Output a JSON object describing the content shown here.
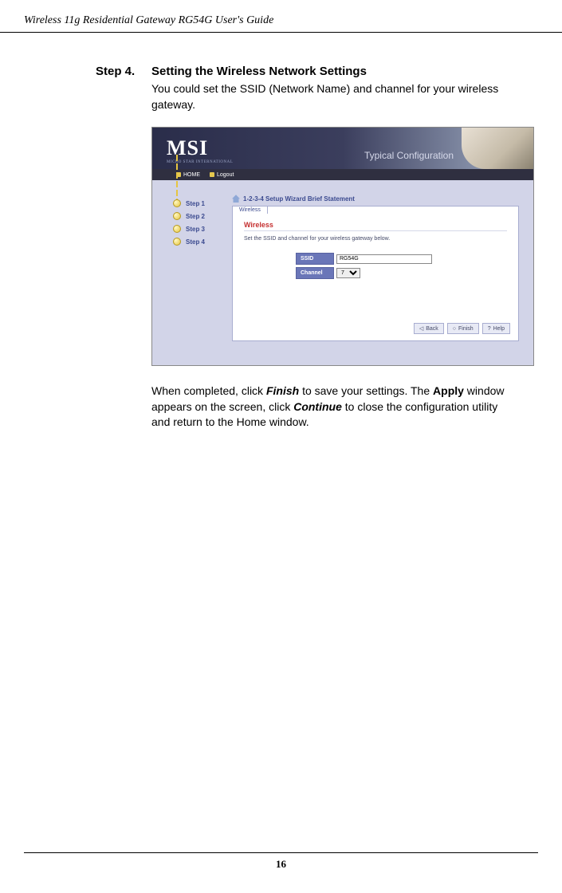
{
  "header": "Wireless 11g Residential Gateway RG54G User's Guide",
  "step": {
    "label": "Step 4.",
    "title": "Setting the Wireless Network Settings",
    "body": "You could set the SSID (Network Name) and channel for your wireless gateway."
  },
  "screenshot": {
    "logo": "MSI",
    "sublogo": "MICRO STAR INTERNATIONAL",
    "typical": "Typical Configuration",
    "nav": {
      "home": "HOME",
      "logout": "Logout"
    },
    "steps": [
      "Step 1",
      "Step 2",
      "Step 3",
      "Step 4"
    ],
    "breadcrumb": "1-2-3-4 Setup Wizard Brief Statement",
    "tab": "Wireless",
    "section_title": "Wireless",
    "desc": "Set the SSID and channel for your wireless gateway below.",
    "form": {
      "ssid_label": "SSID",
      "ssid_value": "RG54G",
      "channel_label": "Channel",
      "channel_value": "7"
    },
    "buttons": {
      "back": "Back",
      "finish": "Finish",
      "help": "Help"
    }
  },
  "post": {
    "p1a": "When completed, click ",
    "finish": "Finish",
    "p1b": " to save your settings.  The ",
    "apply": "Apply",
    "p1c": " window appears on the screen, click ",
    "continue": "Continue",
    "p1d": " to close the configuration utility and return to the Home window."
  },
  "page_number": "16"
}
